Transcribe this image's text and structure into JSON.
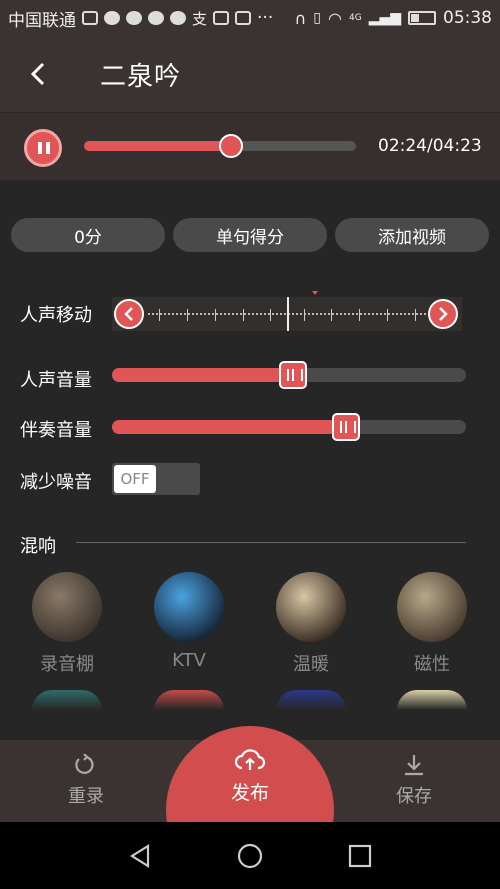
{
  "status_bar": {
    "carrier": "中国联通",
    "network": "4G",
    "time": "05:38",
    "more": "···"
  },
  "header": {
    "title": "二泉吟"
  },
  "player": {
    "elapsed_total": "02:24/04:23",
    "progress": 0.54
  },
  "pills": [
    "0分",
    "单句得分",
    "添加视频"
  ],
  "controls": {
    "voice_shift_label": "人声移动",
    "voice_volume_label": "人声音量",
    "voice_volume": 0.51,
    "accompaniment_label": "伴奏音量",
    "accompaniment_volume": 0.66,
    "noise_label": "减少噪音",
    "noise_toggle": "OFF"
  },
  "reverb": {
    "title": "混响",
    "effects": [
      {
        "label": "录音棚",
        "color_a": "#8a7a66",
        "color_b": "#3b342e"
      },
      {
        "label": "KTV",
        "color_a": "#4aa3e0",
        "color_b": "#15253a"
      },
      {
        "label": "温暖",
        "color_a": "#d9c5a3",
        "color_b": "#3a2e24"
      },
      {
        "label": "磁性",
        "color_a": "#b8a88a",
        "color_b": "#4a3c30"
      }
    ],
    "second_row_colors": [
      "#2f6b6a",
      "#c44a4a",
      "#2a3a8a",
      "#d9cfa8"
    ]
  },
  "bottom_bar": {
    "rerecord": "重录",
    "publish": "发布",
    "save": "保存"
  },
  "colors": {
    "accent": "#e05555",
    "bar": "#3a3331"
  }
}
